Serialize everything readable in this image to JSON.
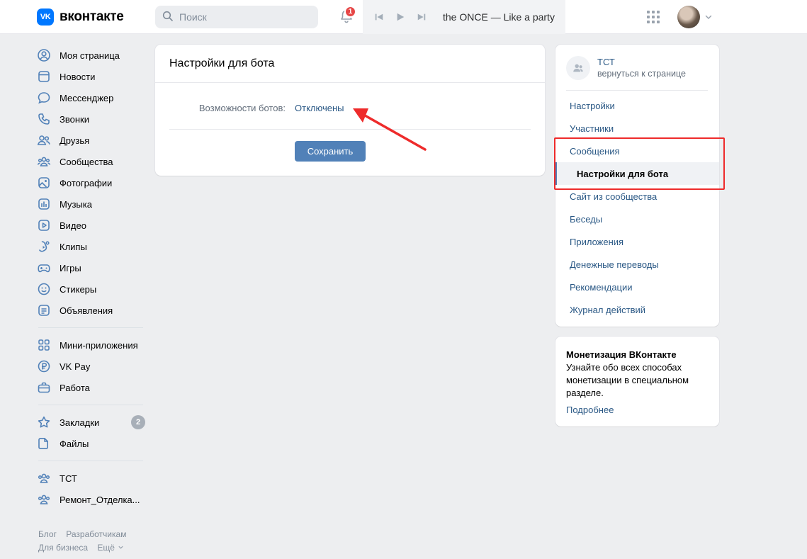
{
  "header": {
    "logo_badge": "VK",
    "logo_text": "вконтакте",
    "search_placeholder": "Поиск",
    "notification_count": "1",
    "player_title": "the ONCE — Like a party"
  },
  "nav": {
    "group1": [
      {
        "label": "Моя страница",
        "icon": "user-circle-icon"
      },
      {
        "label": "Новости",
        "icon": "news-icon"
      },
      {
        "label": "Мессенджер",
        "icon": "message-icon"
      },
      {
        "label": "Звонки",
        "icon": "phone-icon"
      },
      {
        "label": "Друзья",
        "icon": "friends-icon"
      },
      {
        "label": "Сообщества",
        "icon": "communities-icon"
      },
      {
        "label": "Фотографии",
        "icon": "photo-icon"
      },
      {
        "label": "Музыка",
        "icon": "music-icon"
      },
      {
        "label": "Видео",
        "icon": "video-icon"
      },
      {
        "label": "Клипы",
        "icon": "clips-icon"
      },
      {
        "label": "Игры",
        "icon": "gamepad-icon"
      },
      {
        "label": "Стикеры",
        "icon": "sticker-icon"
      },
      {
        "label": "Объявления",
        "icon": "ads-icon"
      }
    ],
    "group2": [
      {
        "label": "Мини-приложения",
        "icon": "grid-icon"
      },
      {
        "label": "VK Pay",
        "icon": "ruble-icon"
      },
      {
        "label": "Работа",
        "icon": "briefcase-icon"
      }
    ],
    "group3": [
      {
        "label": "Закладки",
        "icon": "star-icon",
        "badge": "2"
      },
      {
        "label": "Файлы",
        "icon": "file-icon"
      }
    ],
    "group4": [
      {
        "label": "ТСТ",
        "icon": "community-icon"
      },
      {
        "label": "Ремонт_Отделка...",
        "icon": "community-icon"
      }
    ],
    "footer": [
      "Блог",
      "Разработчикам",
      "Для бизнеса",
      "Ещё"
    ]
  },
  "main": {
    "title": "Настройки для бота",
    "setting_label": "Возможности ботов:",
    "setting_value": "Отключены",
    "save_label": "Сохранить"
  },
  "right_menu": {
    "owner_name": "ТСТ",
    "owner_back": "вернуться к странице",
    "items": [
      {
        "label": "Настройки"
      },
      {
        "label": "Участники"
      },
      {
        "label": "Сообщения"
      },
      {
        "label": "Настройки для бота",
        "active": true
      },
      {
        "label": "Сайт из сообщества"
      },
      {
        "label": "Беседы"
      },
      {
        "label": "Приложения"
      },
      {
        "label": "Денежные переводы"
      },
      {
        "label": "Рекомендации"
      },
      {
        "label": "Журнал действий"
      }
    ]
  },
  "promo": {
    "title": "Монетизация ВКонтакте",
    "text": "Узнайте обо всех способах монетизации в специальном разделе.",
    "link": "Подробнее"
  },
  "colors": {
    "accent": "#5181b8",
    "link": "#2a5885",
    "annotation_red": "#ee2b2b"
  }
}
